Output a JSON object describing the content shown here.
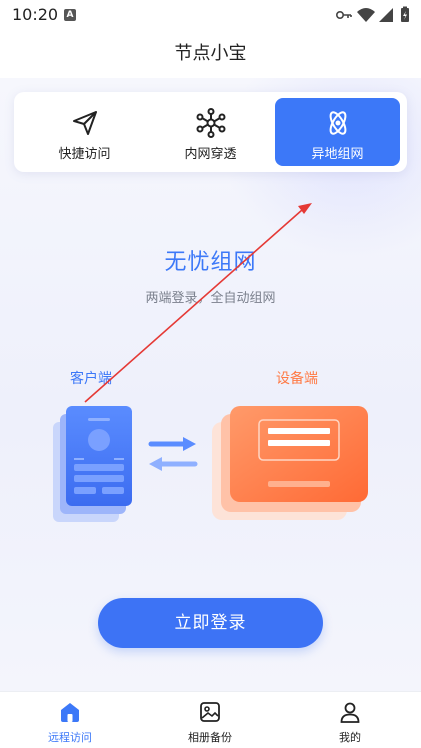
{
  "status_bar": {
    "time": "10:20",
    "notification_icon": "A",
    "icons": [
      "key-icon",
      "wifi-icon",
      "signal-icon",
      "battery-icon"
    ]
  },
  "header": {
    "title": "节点小宝"
  },
  "modes": {
    "items": [
      {
        "label": "快捷访问",
        "icon": "paper-plane-icon",
        "active": false
      },
      {
        "label": "内网穿透",
        "icon": "network-nodes-icon",
        "active": false
      },
      {
        "label": "异地组网",
        "icon": "atom-icon",
        "active": true
      }
    ],
    "active_color": "#3c78f8"
  },
  "intro": {
    "title": "无忧组网",
    "subtitle": "两端登录，全自动组网",
    "client_label": "客户端",
    "device_label": "设备端"
  },
  "login_button": {
    "label": "立即登录"
  },
  "tab_bar": {
    "items": [
      {
        "label": "远程访问",
        "icon": "home-icon",
        "active": true
      },
      {
        "label": "相册备份",
        "icon": "photo-icon",
        "active": false
      },
      {
        "label": "我的",
        "icon": "user-icon",
        "active": false
      }
    ]
  },
  "colors": {
    "primary": "#3c78f8",
    "device_orange": "#ff7a45",
    "annotation_red": "#e53935"
  }
}
